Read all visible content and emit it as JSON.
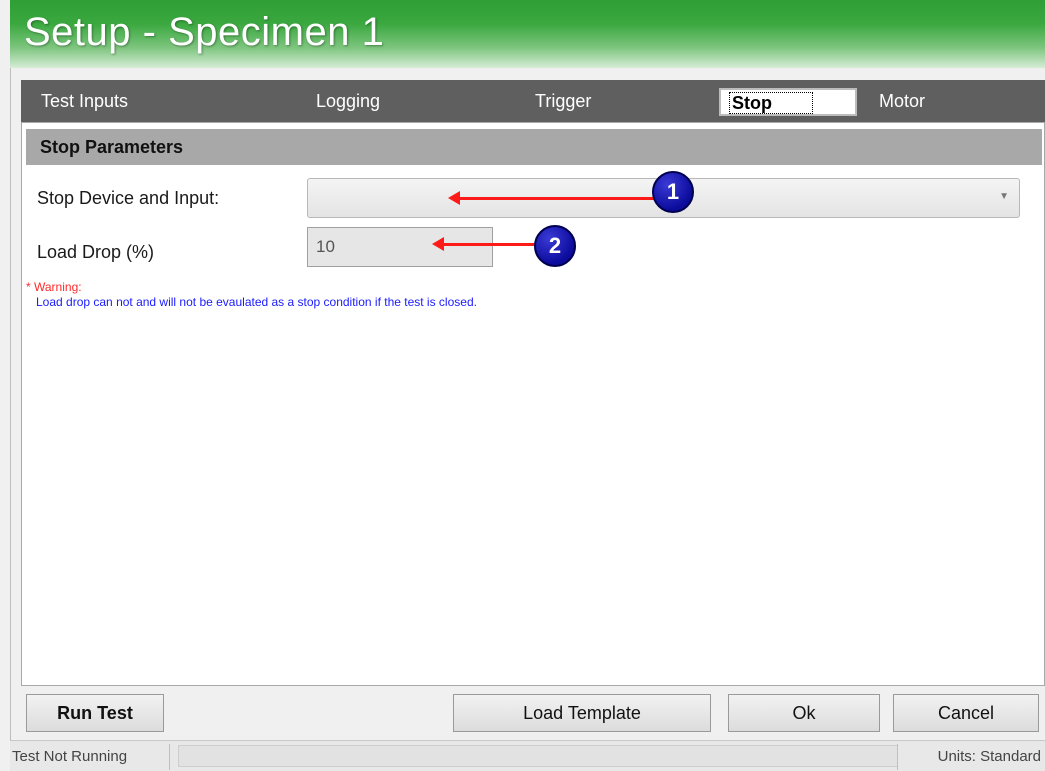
{
  "window": {
    "title": "Setup - Specimen 1"
  },
  "tabs": [
    {
      "label": "Test Inputs",
      "active": false
    },
    {
      "label": "Logging",
      "active": false
    },
    {
      "label": "Trigger",
      "active": false
    },
    {
      "label": "Stop",
      "active": true
    },
    {
      "label": "Motor",
      "active": false
    }
  ],
  "stop_parameters": {
    "header": "Stop Parameters",
    "stop_device_label": "Stop Device and Input:",
    "stop_device_value": "",
    "load_drop_label": "Load Drop (%)",
    "load_drop_value": "10",
    "warning_title": "* Warning:",
    "warning_text": "Load drop can not and will not be evaulated as a stop condition if the test is closed."
  },
  "callouts": [
    {
      "number": "1"
    },
    {
      "number": "2"
    }
  ],
  "buttons": {
    "run_test": "Run Test",
    "load_template": "Load Template",
    "ok": "Ok",
    "cancel": "Cancel"
  },
  "status": {
    "test_state": "Test Not Running",
    "units": "Units:  Standard"
  },
  "colors": {
    "title_green": "#2f9e35",
    "tabbar": "#5f5f5f",
    "warning_red": "#ff2a2a",
    "warning_blue": "#1b1bff",
    "callout_badge": "#0b0b9c",
    "callout_arrow": "#ff1a1a"
  }
}
